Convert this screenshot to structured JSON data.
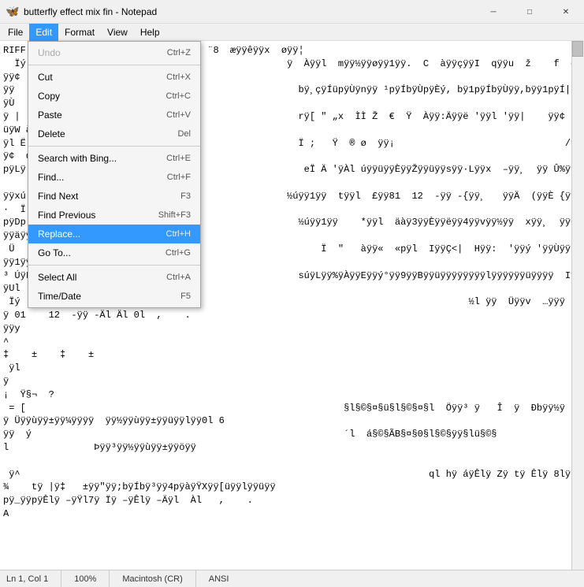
{
  "titleBar": {
    "title": "butterfly effect mix fin - Notepad",
    "icon": "🦋",
    "minimizeLabel": "─",
    "maximizeLabel": "□",
    "closeLabel": "✕"
  },
  "menuBar": {
    "items": [
      "File",
      "Edit",
      "Format",
      "View",
      "Help"
    ],
    "activeItem": "Edit"
  },
  "editMenu": {
    "items": [
      {
        "label": "Undo",
        "shortcut": "Ctrl+Z",
        "disabled": true
      },
      {
        "label": "separator"
      },
      {
        "label": "Cut",
        "shortcut": "Ctrl+X"
      },
      {
        "label": "Copy",
        "shortcut": "Ctrl+C"
      },
      {
        "label": "Paste",
        "shortcut": "Ctrl+V"
      },
      {
        "label": "Delete",
        "shortcut": "Del"
      },
      {
        "label": "separator"
      },
      {
        "label": "Search with Bing...",
        "shortcut": "Ctrl+E"
      },
      {
        "label": "Find...",
        "shortcut": "Ctrl+F"
      },
      {
        "label": "Find Next",
        "shortcut": "F3"
      },
      {
        "label": "Find Previous",
        "shortcut": "Shift+F3"
      },
      {
        "label": "Replace...",
        "shortcut": "Ctrl+H",
        "highlighted": true
      },
      {
        "label": "Go To...",
        "shortcut": "Ctrl+G"
      },
      {
        "label": "separator"
      },
      {
        "label": "Select All",
        "shortcut": "Ctrl+A"
      },
      {
        "label": "Time/Date",
        "shortcut": "F5"
      }
    ]
  },
  "textContent": "RIFFÿ\n Ïý\nÿÿ\n ÿ |\n ÿl Ë\npÿLÿ\nÿÿxú\npÿDp\n Ü\n³ ÚÿL\nÿ Ïý\nÿÿy^\n ÿl ÿ\n = [\n ÿ ý\n ÿ^",
  "statusBar": {
    "position": "Ln 1, Col 1",
    "zoom": "100%",
    "lineEnding": "Macintosh (CR)",
    "encoding": "ANSI"
  }
}
